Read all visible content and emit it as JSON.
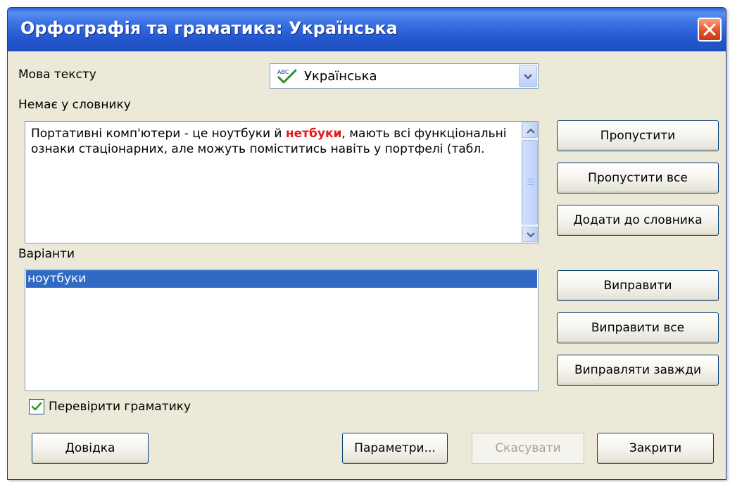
{
  "window": {
    "title": "Орфографія та граматика: Українська"
  },
  "language": {
    "label": "Мова тексту",
    "selected": "Українська",
    "icon": "abc-check-icon"
  },
  "not_in_dictionary": {
    "label": "Немає у словнику",
    "text_before": "Портативні комп'ютери - це ноутбуки й ",
    "error_word": "нетбуки",
    "text_after": ", мають всі функціональні ознаки стаціонарних, але можуть поміститись навіть у портфелі (табл."
  },
  "suggestions": {
    "label": "Варіанти",
    "items": [
      "ноутбуки"
    ]
  },
  "buttons": {
    "ignore": "Пропустити",
    "ignore_all": "Пропустити все",
    "add_to_dictionary": "Додати до словника",
    "change": "Виправити",
    "change_all": "Виправити все",
    "autocorrect": "Виправляти завжди",
    "help": "Довідка",
    "options": "Параметри...",
    "undo": "Скасувати",
    "close": "Закрити"
  },
  "check_grammar": {
    "label": "Перевірити граматику",
    "checked": true
  },
  "colors": {
    "titlebar": "#2458cf",
    "dialog_bg": "#ece9d8",
    "selection": "#316ac5",
    "error_word": "#e21b1b"
  }
}
